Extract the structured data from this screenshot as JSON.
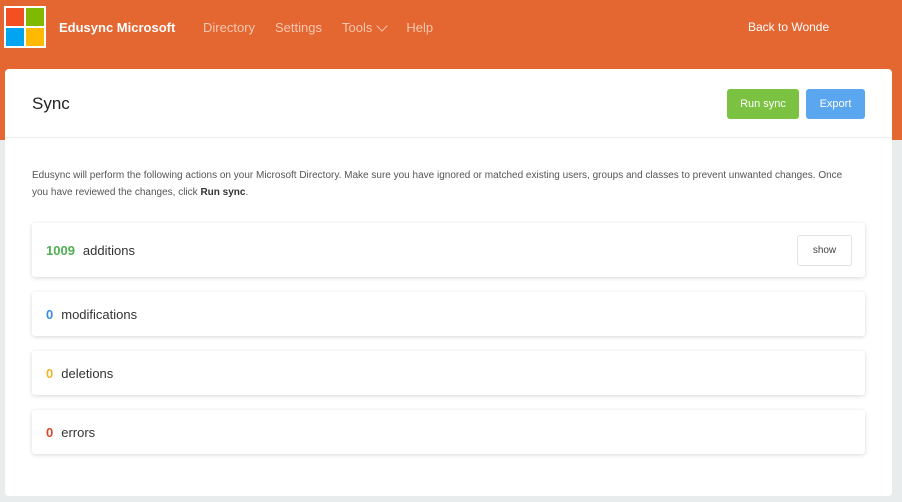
{
  "nav": {
    "brand": "Edusync Microsoft",
    "links": [
      "Directory",
      "Settings",
      "Tools",
      "Help"
    ],
    "back_label": "Back to Wonde"
  },
  "logo_colors": [
    "#f25022",
    "#7fba00",
    "#00a4ef",
    "#ffb900"
  ],
  "page": {
    "title": "Sync",
    "run_sync_label": "Run sync",
    "export_label": "Export",
    "description_prefix": "Edusync will perform the following actions on your Microsoft Directory. Make sure you have ignored or matched existing users, groups and classes to prevent unwanted changes. Once you have reviewed the changes, click ",
    "description_bold": "Run sync",
    "description_suffix": "."
  },
  "summary": [
    {
      "count": "1009",
      "label": "additions",
      "color": "#4caf50",
      "show_label": "show"
    },
    {
      "count": "0",
      "label": "modifications",
      "color": "#3b8ae0"
    },
    {
      "count": "0",
      "label": "deletions",
      "color": "#f0b429"
    },
    {
      "count": "0",
      "label": "errors",
      "color": "#d9462b"
    }
  ]
}
